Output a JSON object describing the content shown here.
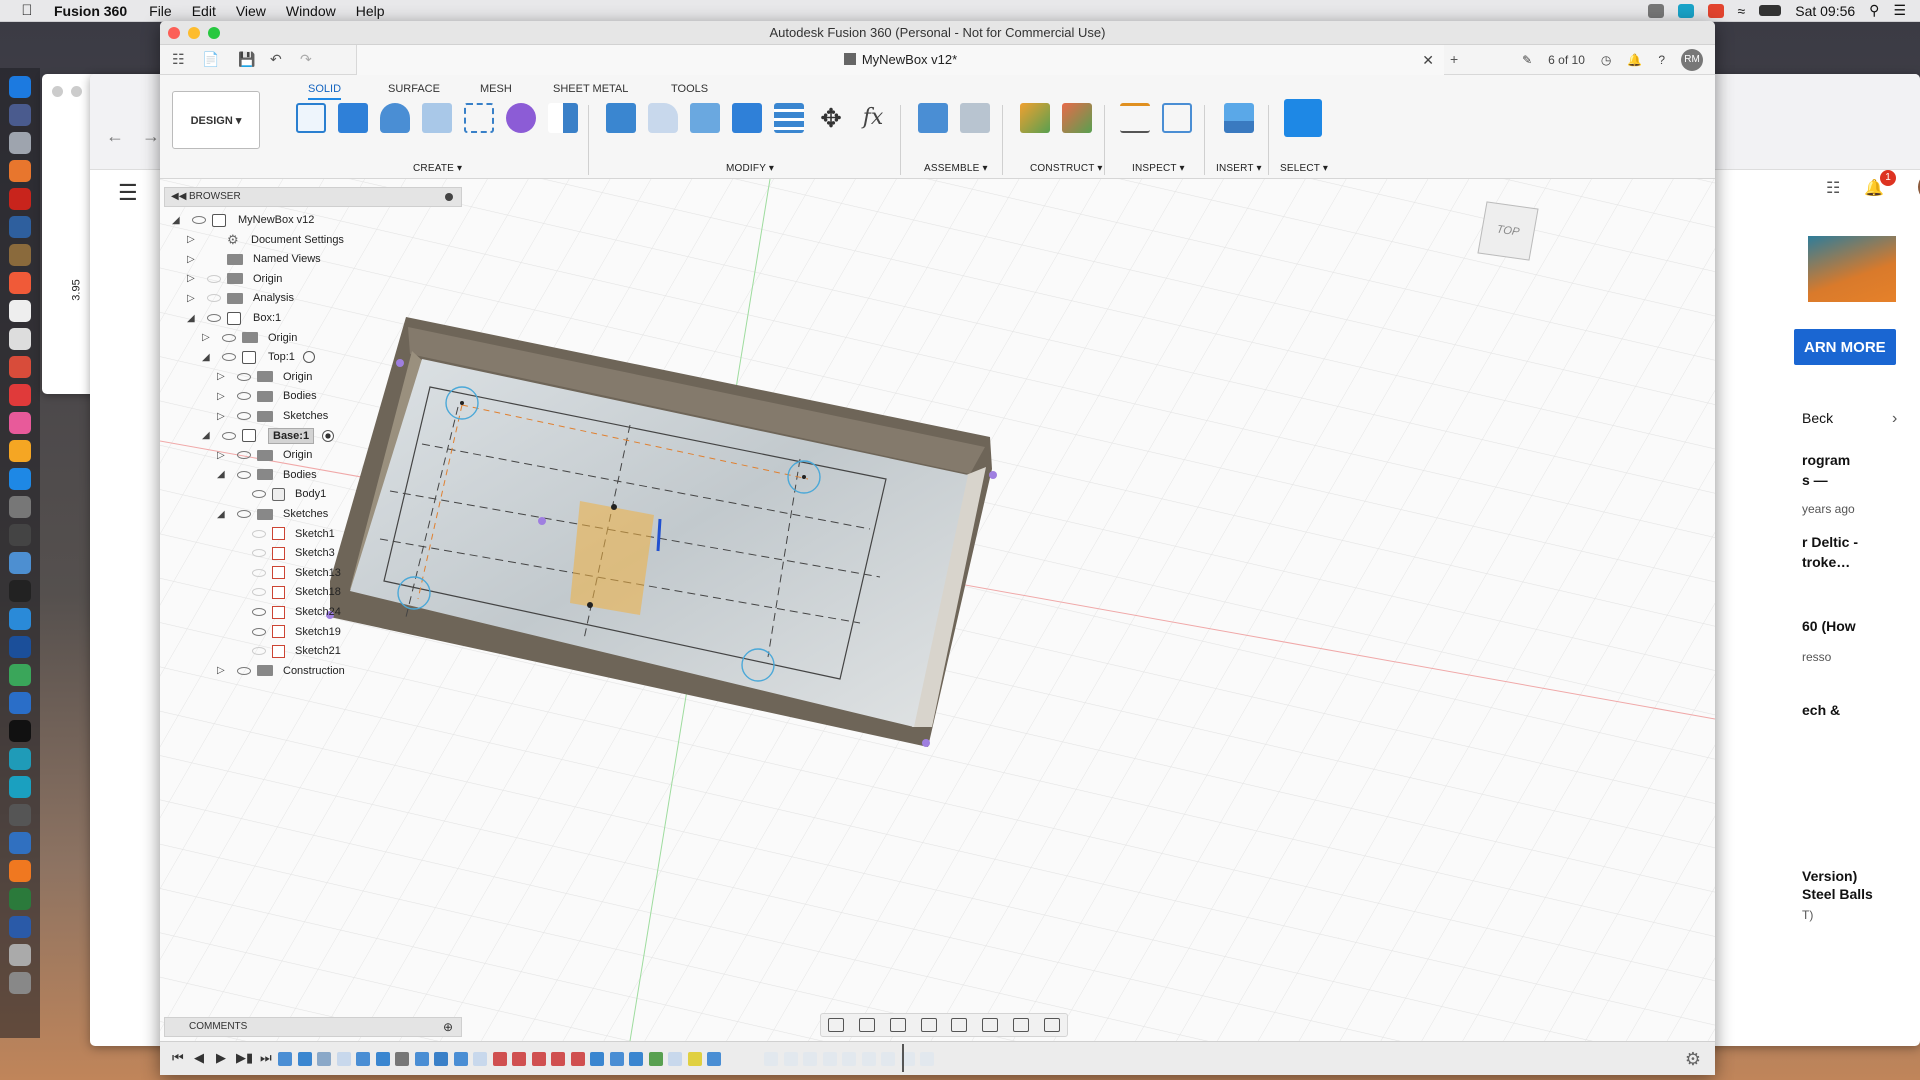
{
  "menubar": {
    "app_name": "Fusion 360",
    "menus": [
      "File",
      "Edit",
      "View",
      "Window",
      "Help"
    ],
    "clock": "Sat 09:56"
  },
  "bg_window": {
    "dimension": "3.95"
  },
  "browser_bg": {
    "learn_more": "ARN MORE",
    "badge": "1",
    "items": [
      {
        "title": "Beck",
        "sub": ""
      },
      {
        "title": "rogram",
        "sub": ""
      },
      {
        "title": "s —",
        "sub": "years ago"
      },
      {
        "title": "r Deltic -",
        "sub": ""
      },
      {
        "title": "troke…",
        "sub": ""
      },
      {
        "title": "60 (How",
        "sub": "resso"
      },
      {
        "title": "ech &",
        "sub": ""
      },
      {
        "title": " Version)",
        "sub": ""
      },
      {
        "title": "Steel Balls",
        "sub": "T)"
      }
    ]
  },
  "fusion": {
    "window_title": "Autodesk Fusion 360 (Personal - Not for Commercial Use)",
    "doc_tab": "MyNewBox v12*",
    "version_count": "6 of 10",
    "user_initials": "RM",
    "workspace": "DESIGN",
    "ribbon_tabs": [
      "SOLID",
      "SURFACE",
      "MESH",
      "SHEET METAL",
      "TOOLS"
    ],
    "active_tab": "SOLID",
    "groups": [
      "CREATE",
      "MODIFY",
      "ASSEMBLE",
      "CONSTRUCT",
      "INSPECT",
      "INSERT",
      "SELECT"
    ],
    "browser_title": "BROWSER",
    "comments_title": "COMMENTS",
    "viewcube_label": "TOP"
  },
  "tree": [
    {
      "label": "MyNewBox v12",
      "indent": 0,
      "icon": "component",
      "expanded": true,
      "eye": "on"
    },
    {
      "label": "Document Settings",
      "indent": 1,
      "icon": "gear",
      "expanded": false,
      "eye": "none"
    },
    {
      "label": "Named Views",
      "indent": 1,
      "icon": "folder",
      "expanded": false,
      "eye": "none"
    },
    {
      "label": "Origin",
      "indent": 1,
      "icon": "folder",
      "expanded": false,
      "eye": "off"
    },
    {
      "label": "Analysis",
      "indent": 1,
      "icon": "folder",
      "expanded": false,
      "eye": "off"
    },
    {
      "label": "Box:1",
      "indent": 1,
      "icon": "component",
      "expanded": true,
      "eye": "on"
    },
    {
      "label": "Origin",
      "indent": 2,
      "icon": "folder",
      "expanded": false,
      "eye": "on"
    },
    {
      "label": "Top:1",
      "indent": 2,
      "icon": "component",
      "expanded": true,
      "eye": "on",
      "radio": "off"
    },
    {
      "label": "Origin",
      "indent": 3,
      "icon": "folder",
      "expanded": false,
      "eye": "on"
    },
    {
      "label": "Bodies",
      "indent": 3,
      "icon": "folder",
      "expanded": false,
      "eye": "on"
    },
    {
      "label": "Sketches",
      "indent": 3,
      "icon": "folder",
      "expanded": false,
      "eye": "on"
    },
    {
      "label": "Base:1",
      "indent": 2,
      "icon": "component",
      "expanded": true,
      "eye": "on",
      "radio": "on",
      "highlight": true
    },
    {
      "label": "Origin",
      "indent": 3,
      "icon": "folder",
      "expanded": false,
      "eye": "on"
    },
    {
      "label": "Bodies",
      "indent": 3,
      "icon": "folder",
      "expanded": true,
      "eye": "on"
    },
    {
      "label": "Body1",
      "indent": 4,
      "icon": "body",
      "expanded": null,
      "eye": "on"
    },
    {
      "label": "Sketches",
      "indent": 3,
      "icon": "folder",
      "expanded": true,
      "eye": "on"
    },
    {
      "label": "Sketch1",
      "indent": 4,
      "icon": "sketch",
      "expanded": null,
      "eye": "off"
    },
    {
      "label": "Sketch3",
      "indent": 4,
      "icon": "sketch",
      "expanded": null,
      "eye": "off"
    },
    {
      "label": "Sketch13",
      "indent": 4,
      "icon": "sketch",
      "expanded": null,
      "eye": "off"
    },
    {
      "label": "Sketch18",
      "indent": 4,
      "icon": "sketch",
      "expanded": null,
      "eye": "off"
    },
    {
      "label": "Sketch24",
      "indent": 4,
      "icon": "sketch",
      "expanded": null,
      "eye": "on"
    },
    {
      "label": "Sketch19",
      "indent": 4,
      "icon": "sketch",
      "expanded": null,
      "eye": "on"
    },
    {
      "label": "Sketch21",
      "indent": 4,
      "icon": "sketch",
      "expanded": null,
      "eye": "off"
    },
    {
      "label": "Construction",
      "indent": 3,
      "icon": "folder",
      "expanded": false,
      "eye": "on"
    }
  ],
  "colors": {
    "box_wall": "#6e6558",
    "box_floor": "#c9cfd3",
    "accent_blue": "#1e88e5",
    "sketch_highlight": "#f0b040"
  }
}
